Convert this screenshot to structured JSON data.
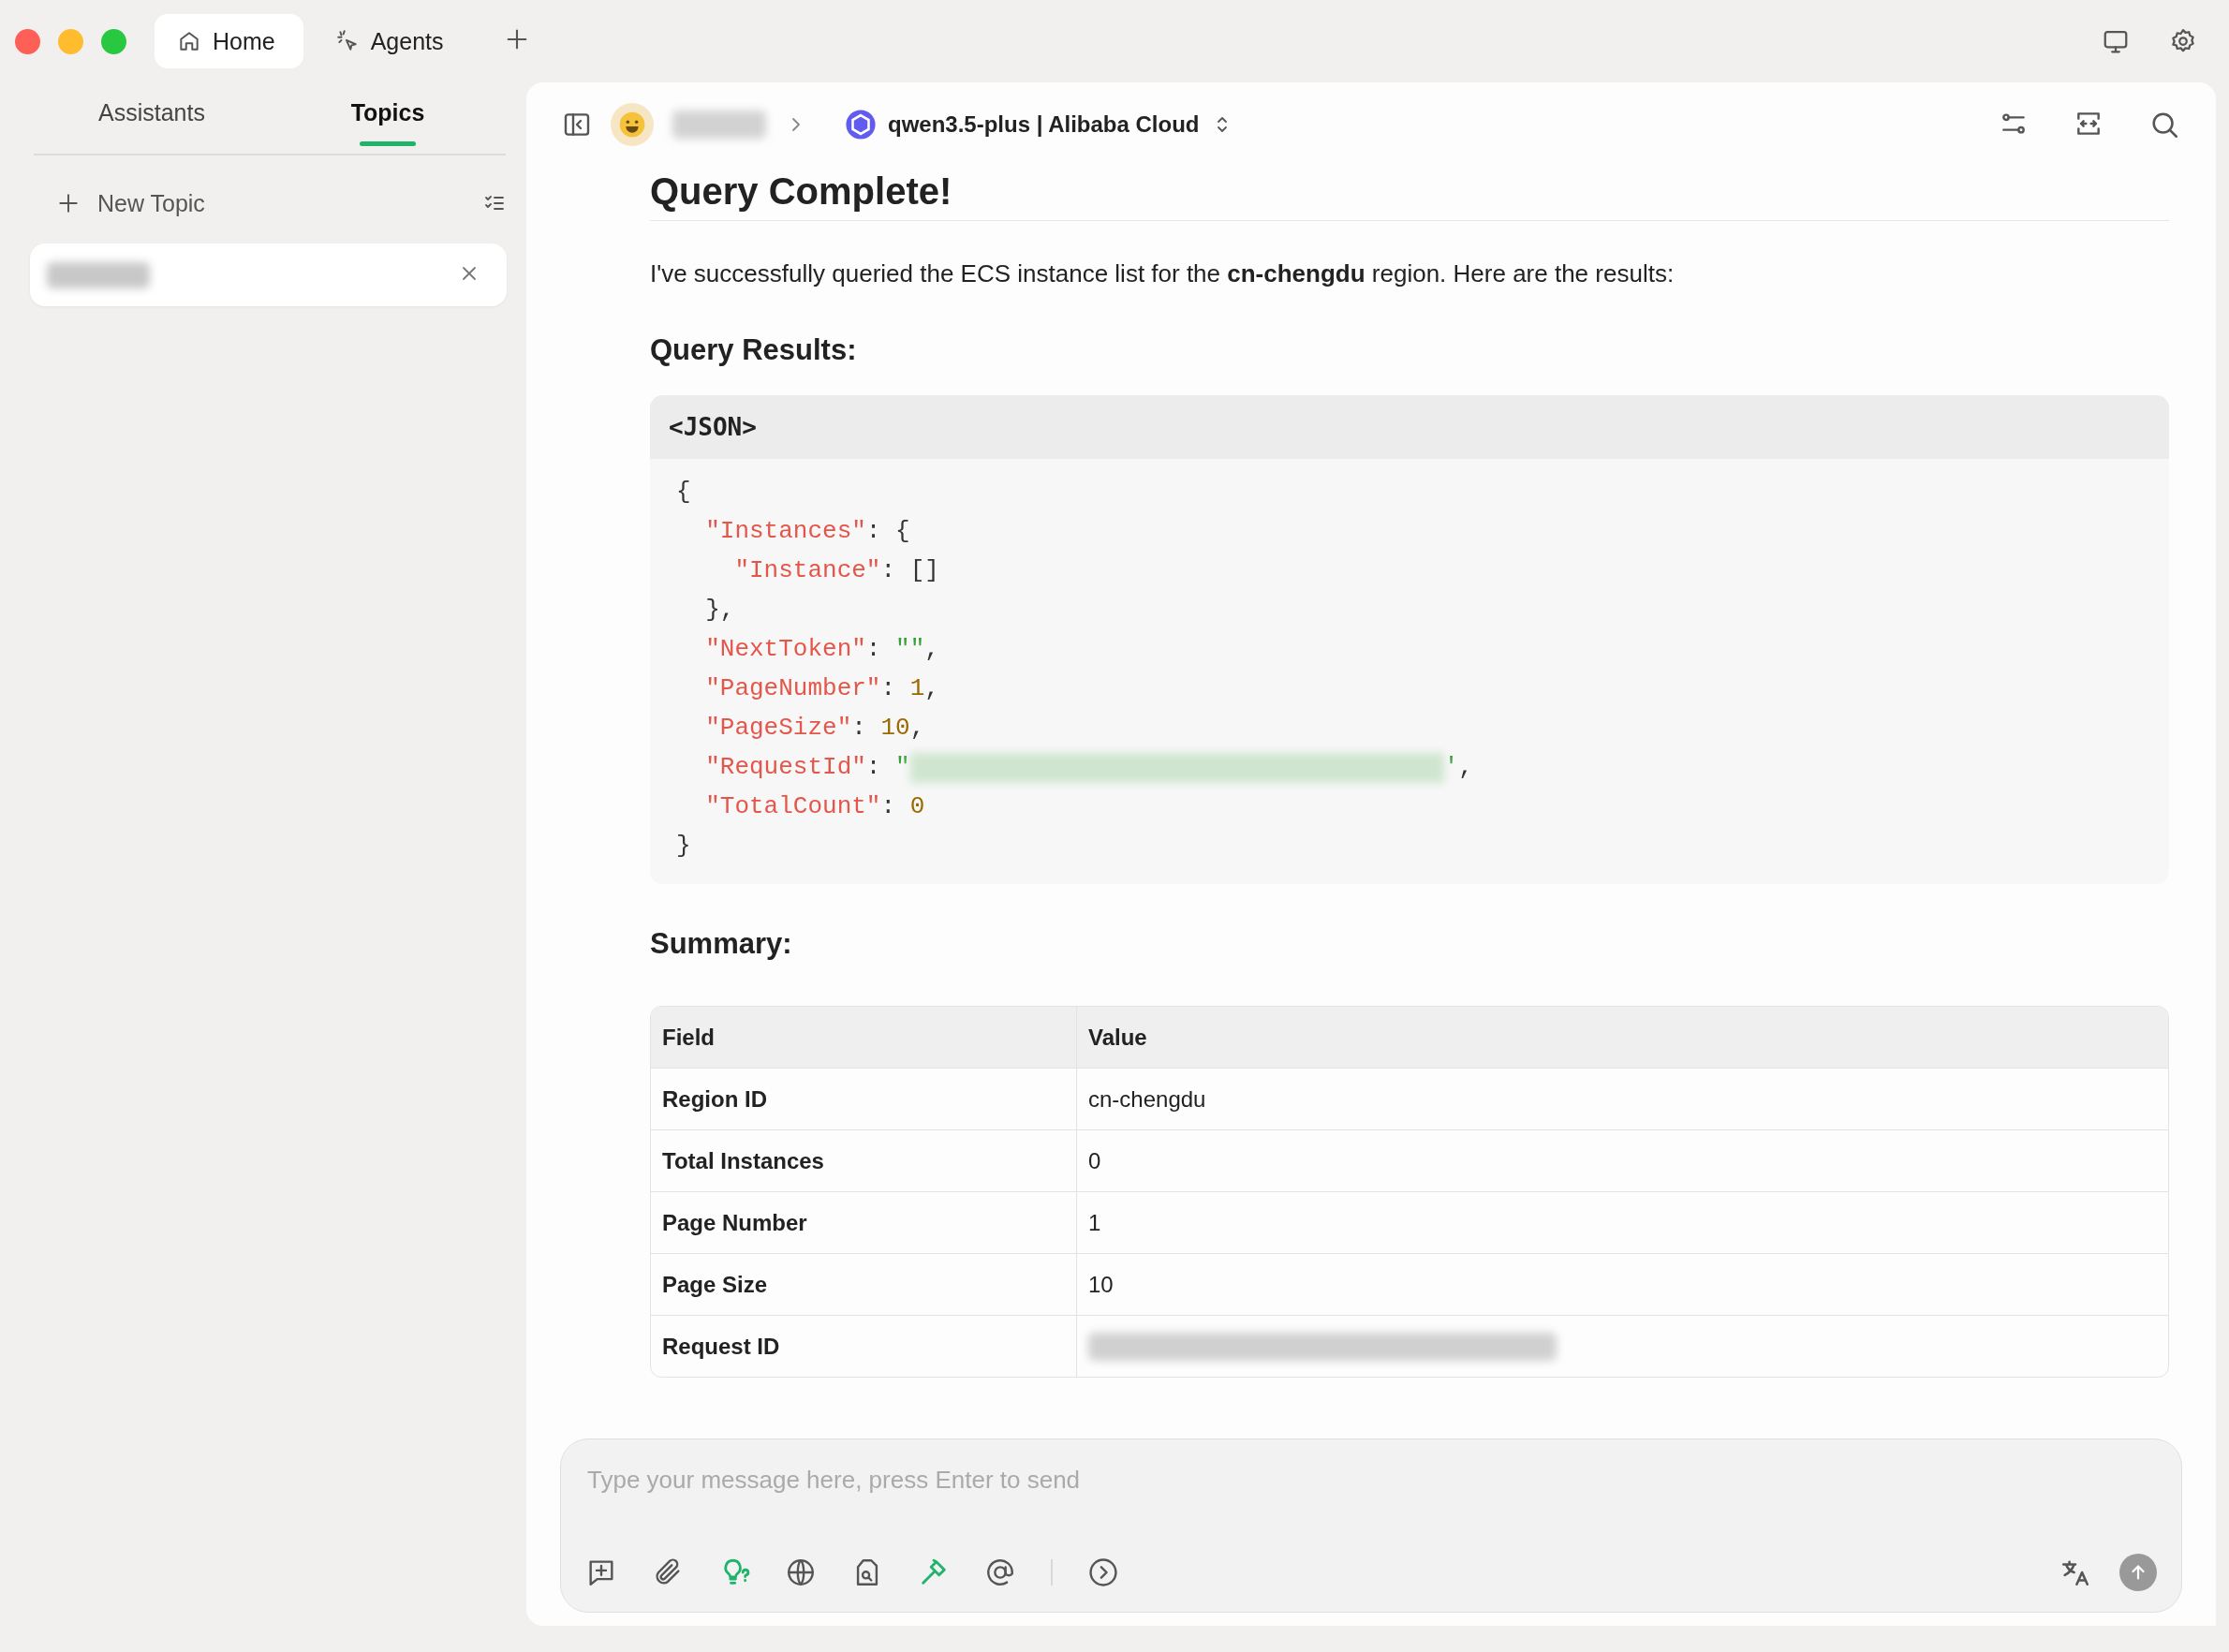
{
  "window": {
    "tabs": [
      {
        "label": "Home",
        "kind": "home",
        "selected": true
      },
      {
        "label": "Agents",
        "kind": "agents",
        "selected": false
      }
    ]
  },
  "sidebar": {
    "tabs": [
      {
        "label": "Assistants",
        "selected": false
      },
      {
        "label": "Topics",
        "selected": true
      }
    ],
    "new_topic": "New Topic",
    "topics": [
      {
        "selected": true
      }
    ]
  },
  "header": {
    "model": "qwen3.5-plus | Alibaba Cloud"
  },
  "message": {
    "blocks": [
      {
        "kind": "title",
        "text": "Query Complete!"
      },
      {
        "kind": "paragraph",
        "text": "I've successfully queried the ECS instance list for the **cn-chengdu** region. Here are the results:"
      },
      {
        "kind": "heading",
        "text": "Query Results:"
      },
      {
        "kind": "code",
        "language": "<JSON>",
        "lines": [
          [
            {
              "kind": "punct",
              "text": "{"
            }
          ],
          [
            {
              "kind": "key",
              "text": "  \"Instances\""
            },
            {
              "kind": "punct",
              "text": ": {"
            }
          ],
          [
            {
              "kind": "key",
              "text": "    \"Instance\""
            },
            {
              "kind": "punct",
              "text": ": []"
            }
          ],
          [
            {
              "kind": "punct",
              "text": "  },"
            }
          ],
          [
            {
              "kind": "key",
              "text": "  \"NextToken\""
            },
            {
              "kind": "punct",
              "text": ": "
            },
            {
              "kind": "string",
              "text": "\"\""
            },
            {
              "kind": "punct",
              "text": ","
            }
          ],
          [
            {
              "kind": "key",
              "text": "  \"PageNumber\""
            },
            {
              "kind": "punct",
              "text": ": "
            },
            {
              "kind": "number",
              "text": "1"
            },
            {
              "kind": "punct",
              "text": ","
            }
          ],
          [
            {
              "kind": "key",
              "text": "  \"PageSize\""
            },
            {
              "kind": "punct",
              "text": ": "
            },
            {
              "kind": "number",
              "text": "10"
            },
            {
              "kind": "punct",
              "text": ","
            }
          ],
          [
            {
              "kind": "key",
              "text": "  \"RequestId\""
            },
            {
              "kind": "punct",
              "text": ": "
            },
            {
              "kind": "string",
              "text": "\""
            },
            {
              "kind": "blur"
            },
            {
              "kind": "string",
              "text": "'"
            },
            {
              "kind": "punct",
              "text": ","
            }
          ],
          [
            {
              "kind": "key",
              "text": "  \"TotalCount\""
            },
            {
              "kind": "punct",
              "text": ": "
            },
            {
              "kind": "number",
              "text": "0"
            }
          ],
          [
            {
              "kind": "punct",
              "text": "}"
            }
          ]
        ]
      },
      {
        "kind": "heading",
        "text": "Summary:"
      },
      {
        "kind": "table",
        "columns": [
          "Field",
          "Value"
        ],
        "rows": [
          {
            "field": "Region ID",
            "value": "cn-chengdu"
          },
          {
            "field": "Total Instances",
            "value": "0"
          },
          {
            "field": "Page Number",
            "value": "1"
          },
          {
            "field": "Page Size",
            "value": "10"
          },
          {
            "field": "Request ID"
          }
        ]
      }
    ]
  },
  "composer": {
    "placeholder": "Type your message here, press Enter to send",
    "tools": [
      {
        "kind": "new-context",
        "active": false
      },
      {
        "kind": "attach",
        "active": false
      },
      {
        "kind": "thinking",
        "active": true
      },
      {
        "kind": "web",
        "active": false
      },
      {
        "kind": "knowledge",
        "active": false
      },
      {
        "kind": "tools",
        "active": true
      },
      {
        "kind": "mention",
        "active": false
      },
      {
        "kind": "divider"
      },
      {
        "kind": "more",
        "active": false
      }
    ]
  }
}
